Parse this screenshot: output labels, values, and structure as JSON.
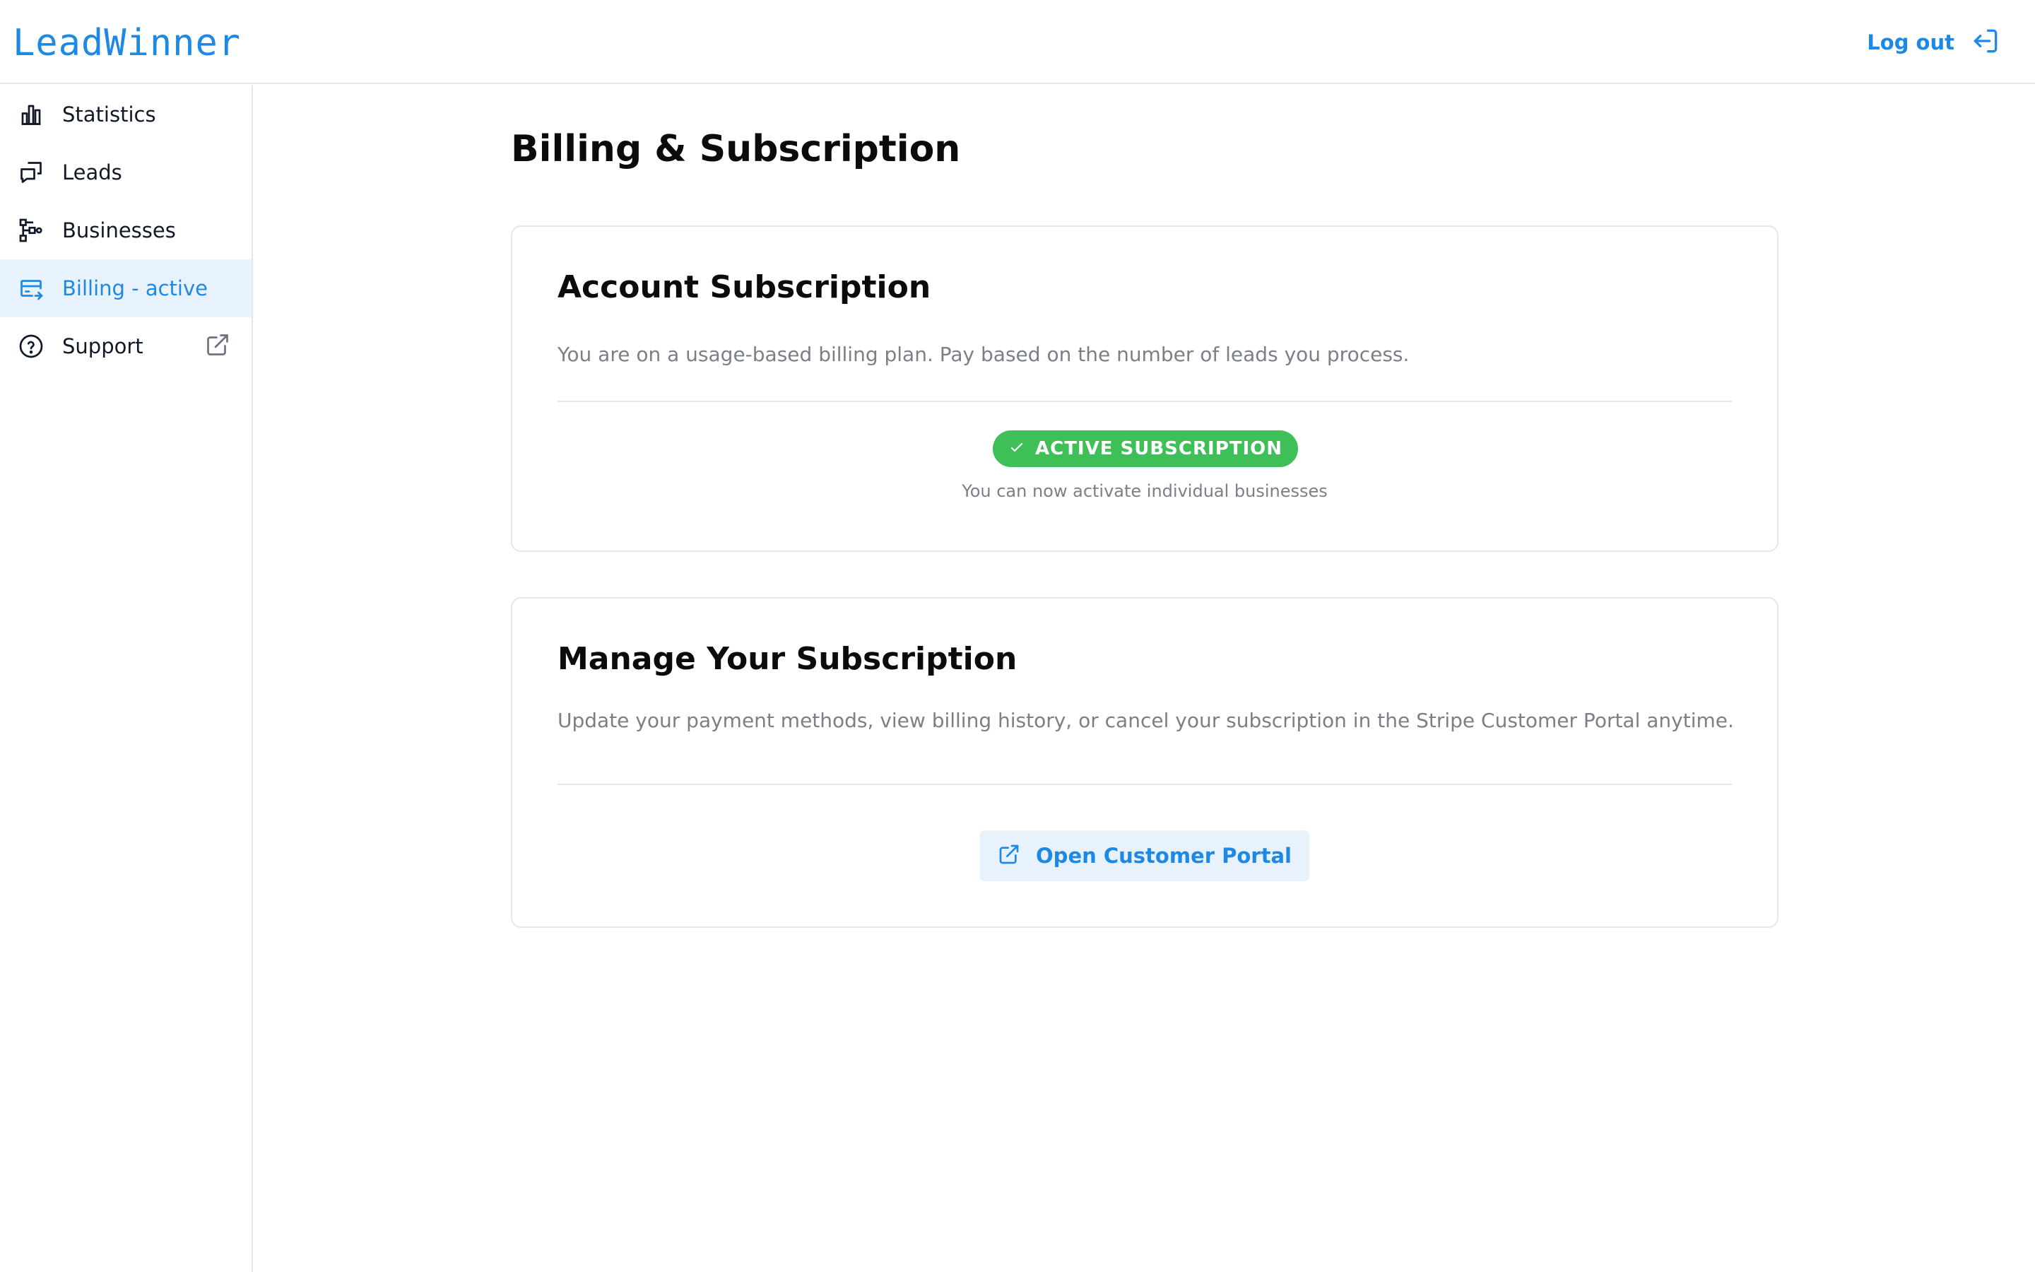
{
  "app": {
    "brand": "LeadWinner",
    "brand_color": "#1e88e5"
  },
  "header": {
    "logout_label": "Log out"
  },
  "sidebar": {
    "items": [
      {
        "label": "Statistics",
        "icon": "bar-chart-icon"
      },
      {
        "label": "Leads",
        "icon": "chat-bubbles-icon"
      },
      {
        "label": "Businesses",
        "icon": "network-icon"
      },
      {
        "label": "Billing - active",
        "icon": "credit-card-icon",
        "active": true
      },
      {
        "label": "Support",
        "icon": "help-circle-icon",
        "external": true
      }
    ]
  },
  "page": {
    "title": "Billing & Subscription"
  },
  "account_card": {
    "title": "Account Subscription",
    "description": "You are on a usage-based billing plan. Pay based on the number of leads you process.",
    "badge_label": "ACTIVE SUBSCRIPTION",
    "badge_color": "#3fbf57",
    "note": "You can now activate individual businesses"
  },
  "manage_card": {
    "title": "Manage Your Subscription",
    "description": "Update your payment methods, view billing history, or cancel your subscription in the Stripe Customer Portal anytime.",
    "button_label": "Open Customer Portal"
  }
}
